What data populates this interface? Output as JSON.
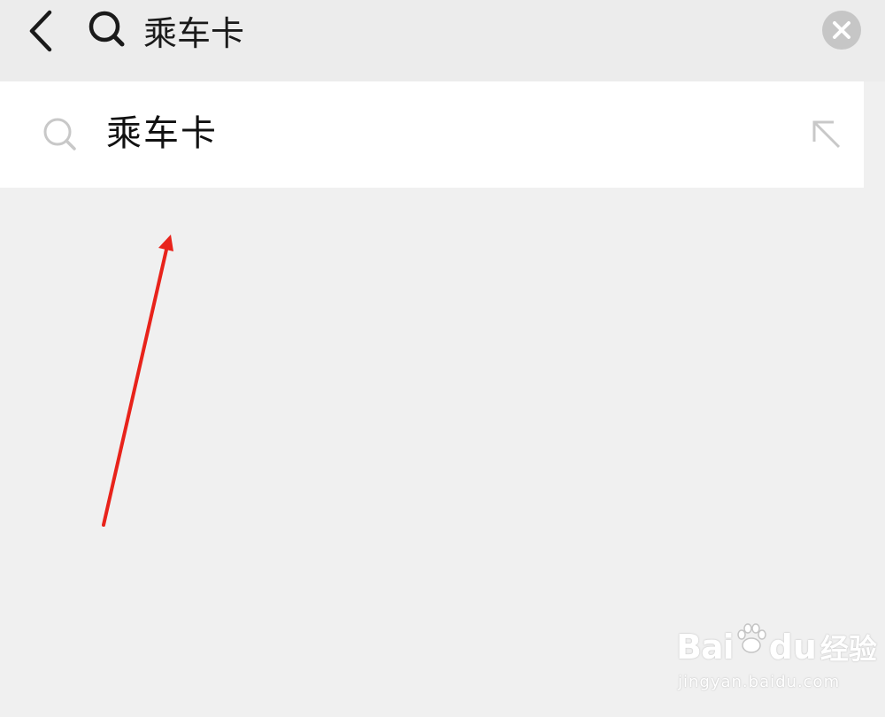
{
  "search": {
    "query": "乘车卡"
  },
  "suggestions": [
    {
      "label": "乘车卡"
    }
  ],
  "annotation": {
    "arrow_color": "#e8231b"
  },
  "watermark": {
    "logo_text_left": "Bai",
    "logo_text_right": "du",
    "product": "经验",
    "url": "jingyan.baidu.com"
  },
  "colors": {
    "header_bg": "#ececec",
    "page_bg": "#f0f0f0",
    "suggestion_bg": "#ffffff",
    "icon_dark": "#1a1a1a",
    "icon_light": "#c8c8c8"
  }
}
